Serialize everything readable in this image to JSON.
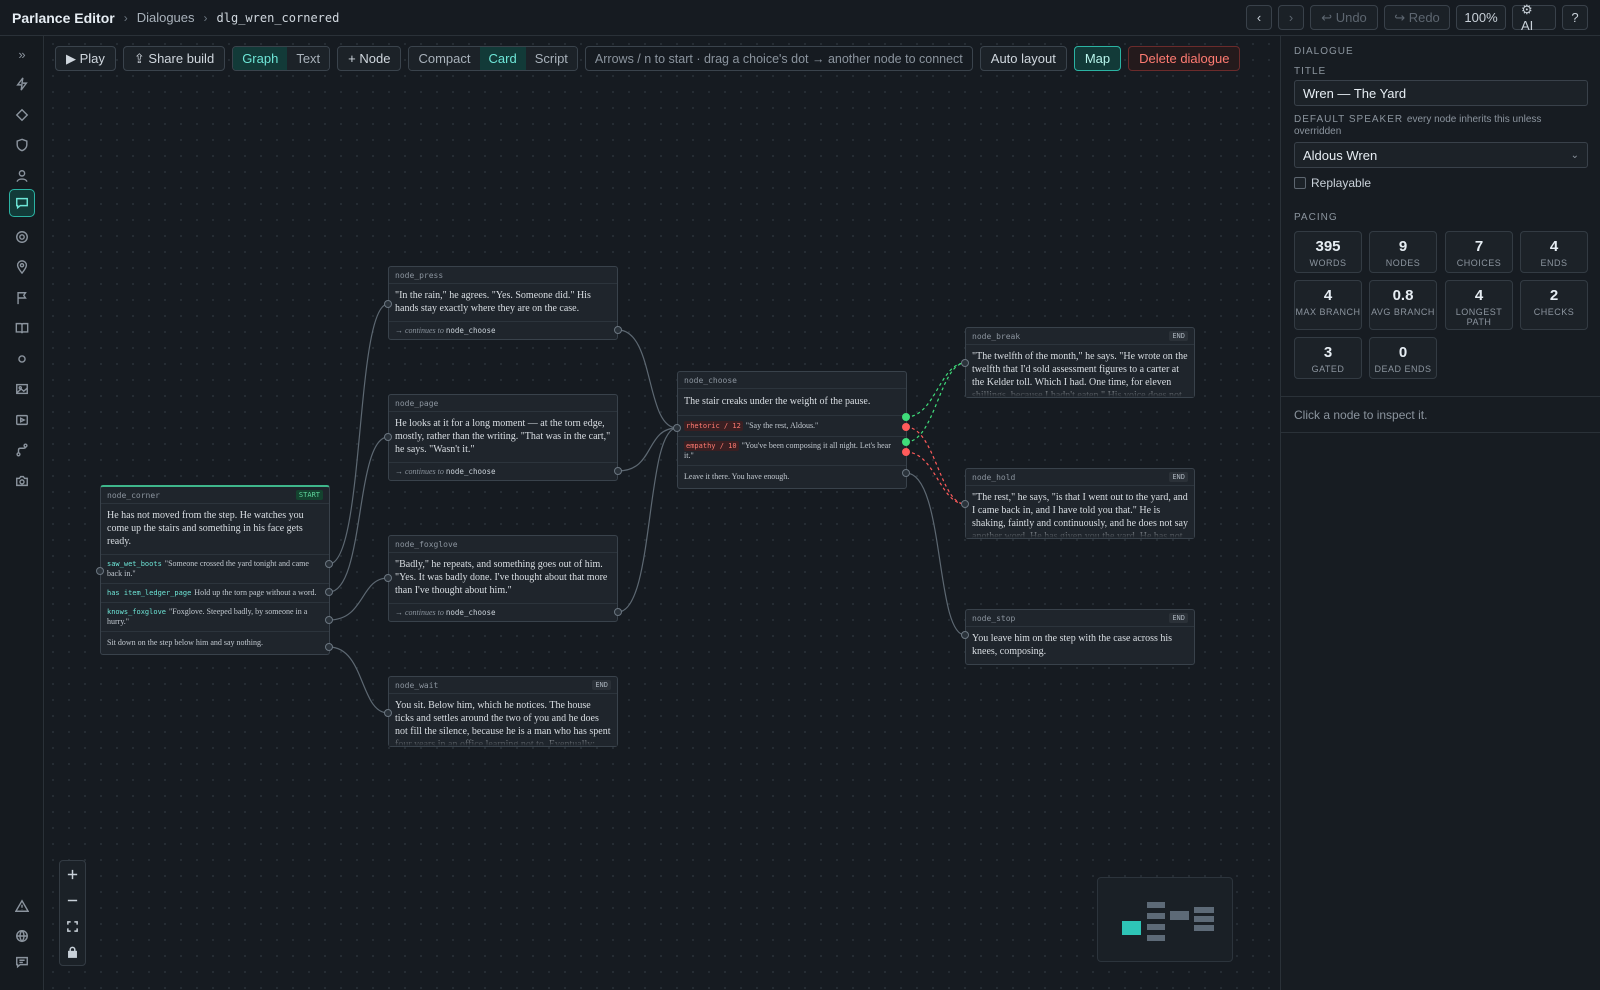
{
  "app": {
    "title": "Parlance Editor",
    "crumb_section": "Dialogues",
    "crumb_id": "dlg_wren_cornered"
  },
  "topbar": {
    "back": "‹",
    "forward": "›",
    "undo": "↩ Undo",
    "redo": "↪ Redo",
    "zoom": "100%",
    "ai": "⚙ AI",
    "help": "?"
  },
  "rail": {
    "expand": "»"
  },
  "toolbar": {
    "play": "▶ Play",
    "share": "⇪ Share build",
    "view_graph": "Graph",
    "view_text": "Text",
    "add_node": "+ Node",
    "density_compact": "Compact",
    "density_card": "Card",
    "density_script": "Script",
    "hint": "Arrows / n to start · drag a choice's dot → another node to connect",
    "auto_layout": "Auto layout",
    "map": "Map",
    "delete": "Delete dialogue"
  },
  "nodes": {
    "corner": {
      "id": "node_corner",
      "badge": "START",
      "text": "He has not moved from the step. He watches you come up the stairs and something in his face gets ready.",
      "choices": [
        {
          "flag": "saw_wet_boots",
          "text": "\"Someone crossed the yard tonight and came back in.\""
        },
        {
          "flag": "has item_ledger_page",
          "text": "Hold up the torn page without a word."
        },
        {
          "flag": "knows_foxglove",
          "text": "\"Foxglove. Steeped badly, by someone in a hurry.\""
        },
        {
          "flag": "",
          "text": "Sit down on the step below him and say nothing."
        }
      ]
    },
    "press": {
      "id": "node_press",
      "text": "\"In the rain,\" he agrees. \"Yes. Someone did.\" His hands stay exactly where they are on the case.",
      "cont_label": "→ continues to",
      "cont": "node_choose"
    },
    "page": {
      "id": "node_page",
      "text": "He looks at it for a long moment — at the torn edge, mostly, rather than the writing. \"That was in the cart,\" he says. \"Wasn't it.\"",
      "cont_label": "→ continues to",
      "cont": "node_choose"
    },
    "foxglove": {
      "id": "node_foxglove",
      "text": "\"Badly,\" he repeats, and something goes out of him. \"Yes. It was badly done. I've thought about that more than I've thought about him.\"",
      "cont_label": "→ continues to",
      "cont": "node_choose"
    },
    "wait": {
      "id": "node_wait",
      "badge": "END",
      "text": "You sit. Below him, which he notices. The house ticks and settles around the two of you and he does not fill the silence, because he is a man who has spent four years in an office learning not to. Eventually: \"You"
    },
    "choose": {
      "id": "node_choose",
      "text": "The stair creaks under the weight of the pause.",
      "choices": [
        {
          "check": "rhetoric / 12",
          "text": "\"Say the rest, Aldous.\""
        },
        {
          "check": "empathy / 10",
          "text": "\"You've been composing it all night. Let's hear it.\""
        },
        {
          "check": "",
          "text": "Leave it there. You have enough."
        }
      ]
    },
    "break": {
      "id": "node_break",
      "badge": "END",
      "text": "\"The twelfth of the month,\" he says. \"He wrote on the twelfth that I'd sold assessment figures to a carter at the Kelder toll. Which I had. One time, for eleven shillings, because I hadn't eaten.\" His voice does not"
    },
    "hold": {
      "id": "node_hold",
      "badge": "END",
      "text": "\"The rest,\" he says, \"is that I went out to the yard, and I came back in, and I have told you that.\" He is shaking, faintly and continuously, and he does not say another word. He has given you the yard. He has not"
    },
    "stop": {
      "id": "node_stop",
      "badge": "END",
      "text": "You leave him on the step with the case across his knees, composing."
    }
  },
  "panel": {
    "section": "DIALOGUE",
    "title_label": "TITLE",
    "title_value": "Wren — The Yard",
    "speaker_label": "DEFAULT SPEAKER",
    "speaker_note": "every node inherits this unless overridden",
    "speaker_value": "Aldous Wren",
    "speaker_caret": "⌄",
    "replayable": "Replayable",
    "pacing_label": "PACING",
    "stats": [
      {
        "v": "395",
        "l": "WORDS"
      },
      {
        "v": "9",
        "l": "NODES"
      },
      {
        "v": "7",
        "l": "CHOICES"
      },
      {
        "v": "4",
        "l": "ENDS"
      },
      {
        "v": "4",
        "l": "MAX BRANCH"
      },
      {
        "v": "0.8",
        "l": "AVG BRANCH"
      },
      {
        "v": "4",
        "l": "LONGEST PATH"
      },
      {
        "v": "2",
        "l": "CHECKS"
      },
      {
        "v": "3",
        "l": "GATED"
      },
      {
        "v": "0",
        "l": "DEAD ENDS"
      }
    ],
    "inspect_hint": "Click a node to inspect it."
  },
  "colors": {
    "accent": "#2ec4b6",
    "success": "#3fdc7a",
    "fail": "#ff5b5b",
    "danger": "#ff7b72"
  }
}
